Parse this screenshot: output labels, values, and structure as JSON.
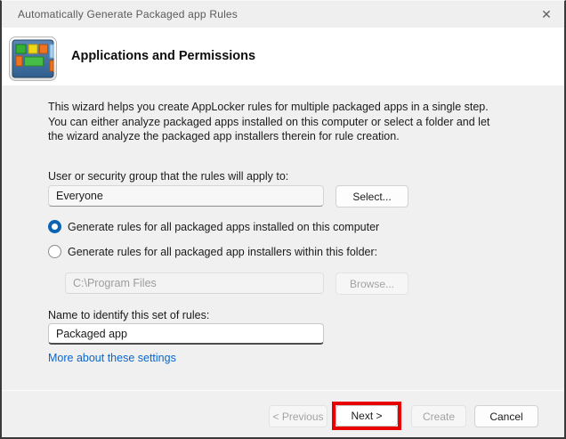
{
  "window": {
    "title": "Automatically Generate Packaged app Rules"
  },
  "icons": {
    "close": "✕"
  },
  "header": {
    "title": "Applications and Permissions"
  },
  "intro": {
    "lines": [
      "This wizard helps you create AppLocker rules for multiple packaged apps in a single step.",
      "You can either analyze packaged apps installed on this computer or select a folder and let",
      "the wizard analyze the packaged app installers therein for rule creation."
    ]
  },
  "user_group": {
    "label": "User or security group that the rules will apply to:",
    "value": "Everyone",
    "select_button": "Select..."
  },
  "options": {
    "installed": {
      "label": "Generate rules for all packaged apps installed on this computer",
      "selected": true
    },
    "folder": {
      "label": "Generate rules for all packaged app installers within this folder:",
      "selected": false
    },
    "folder_path": "C:\\Program Files",
    "browse_button": "Browse..."
  },
  "rule_name": {
    "label": "Name to identify this set of rules:",
    "value": "Packaged app"
  },
  "links": {
    "more_about": "More about these settings"
  },
  "footer": {
    "previous_button": "< Previous",
    "next_button": "Next >",
    "create_button": "Create",
    "cancel_button": "Cancel"
  },
  "colors": {
    "accent_blue": "#0b63b4",
    "link_blue": "#0a66cc",
    "highlight_red": "#e80000",
    "titlebar_bg": "#efefef",
    "dialog_bg": "#f0f0f0"
  }
}
